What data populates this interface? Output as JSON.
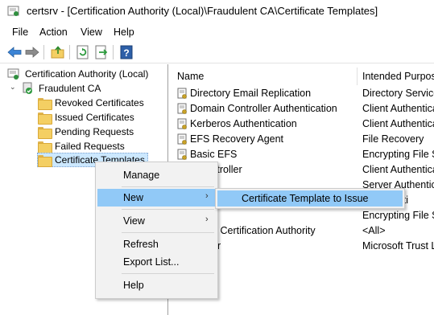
{
  "window": {
    "title": "certsrv - [Certification Authority (Local)\\Fraudulent CA\\Certificate Templates]"
  },
  "menubar": {
    "items": [
      "File",
      "Action",
      "View",
      "Help"
    ]
  },
  "toolbar": {
    "buttons": [
      "back-arrow-icon",
      "forward-arrow-icon",
      "up-folder-icon",
      "refresh-icon",
      "export-list-icon",
      "help-icon"
    ]
  },
  "tree": {
    "root": "Certification Authority (Local)",
    "ca": "Fraudulent CA",
    "folders": [
      "Revoked Certificates",
      "Issued Certificates",
      "Pending Requests",
      "Failed Requests",
      "Certificate Templates"
    ],
    "expander_glyph": "⌄"
  },
  "list": {
    "columns": [
      "Name",
      "Intended Purpose"
    ],
    "rows": [
      {
        "name": "Directory Email Replication",
        "purpose": "Directory Service"
      },
      {
        "name": "Domain Controller Authentication",
        "purpose": "Client Authentica"
      },
      {
        "name": "Kerberos Authentication",
        "purpose": "Client Authentica"
      },
      {
        "name": "EFS Recovery Agent",
        "purpose": "File Recovery"
      },
      {
        "name": "Basic EFS",
        "purpose": "Encrypting File Sy"
      },
      {
        "name": "n Controller",
        "purpose": "Client Authenticati"
      },
      {
        "name": "erver",
        "purpose": "Server Authenticati"
      },
      {
        "name": "",
        "purpose": "uthenticati"
      },
      {
        "name": "",
        "purpose": "Encrypting File Sy"
      },
      {
        "name": "dinate Certification Authority",
        "purpose": "<All>"
      },
      {
        "name": "istrator",
        "purpose": "Microsoft Trust L"
      }
    ]
  },
  "context_menu": {
    "items": [
      {
        "label": "Manage",
        "arrow": ""
      },
      {
        "label": "New",
        "arrow": "›"
      },
      {
        "label": "View",
        "arrow": "›"
      },
      {
        "label": "Refresh",
        "arrow": ""
      },
      {
        "label": "Export List...",
        "arrow": ""
      },
      {
        "label": "Help",
        "arrow": ""
      }
    ]
  },
  "submenu": {
    "item": "Certificate Template to Issue"
  },
  "colors": {
    "highlight": "#91c9f7",
    "tree_selection": "#cce8ff",
    "folder": "#f4cf63"
  }
}
